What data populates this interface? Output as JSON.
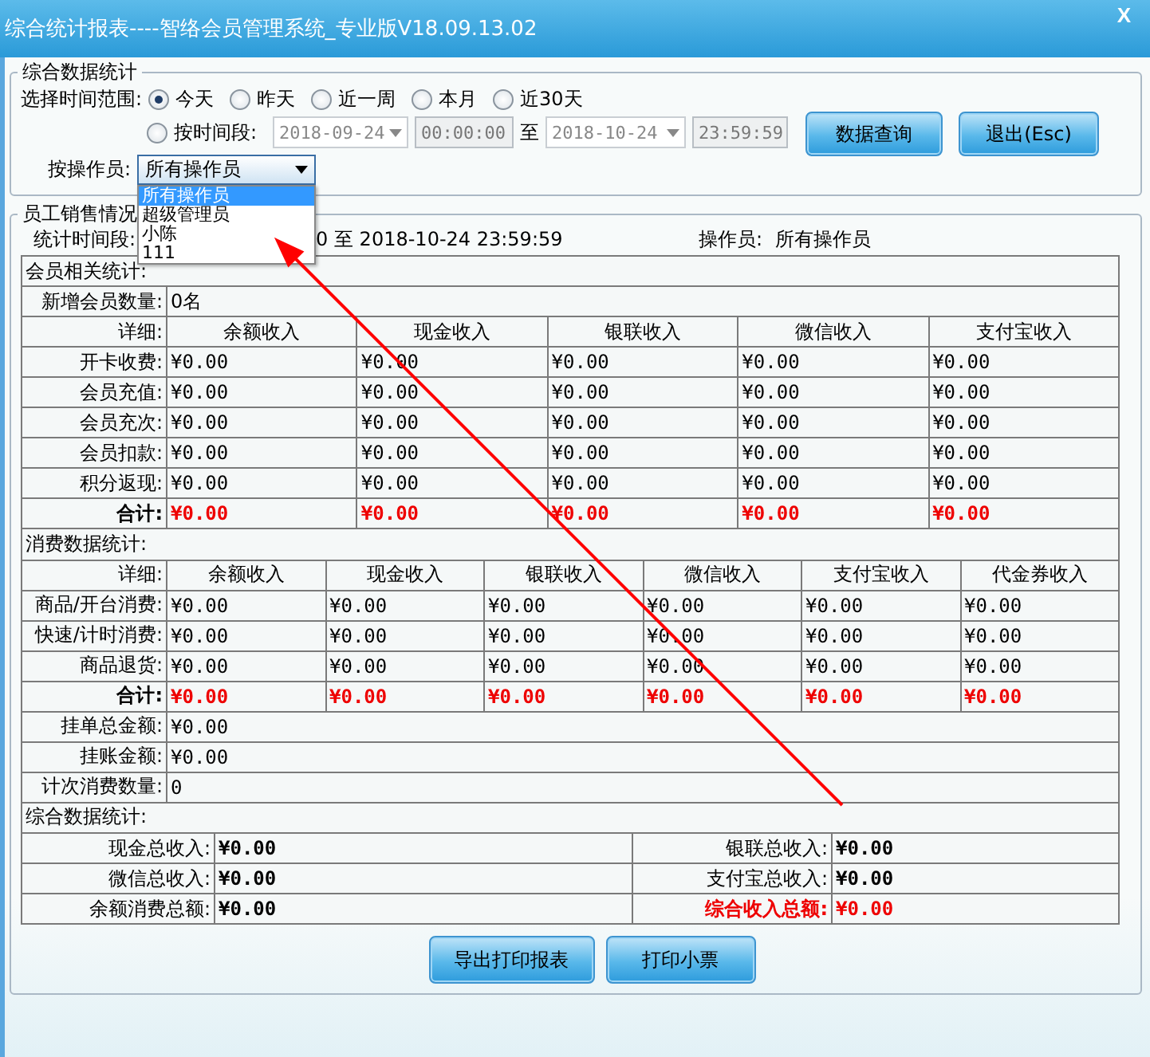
{
  "window": {
    "title": "综合统计报表----智络会员管理系统_专业版V18.09.13.02",
    "close": "X"
  },
  "query": {
    "group_title": "综合数据统计",
    "range_label": "选择时间范围:",
    "ranges": [
      {
        "label": "今天",
        "selected": true
      },
      {
        "label": "昨天",
        "selected": false
      },
      {
        "label": "近一周",
        "selected": false
      },
      {
        "label": "本月",
        "selected": false
      },
      {
        "label": "近30天",
        "selected": false
      }
    ],
    "custom": {
      "label": "按时间段:",
      "selected": false,
      "start_date": "2018-09-24",
      "start_time": "00:00:00",
      "to": "至",
      "end_date": "2018-10-24",
      "end_time": "23:59:59"
    },
    "buttons": [
      "数据查询",
      "退出(Esc)"
    ],
    "operator_label": "按操作员:",
    "operator_value": "所有操作员",
    "expanded": true,
    "operator_options": [
      {
        "label": "所有操作员",
        "selected": true
      },
      {
        "label": "超级管理员",
        "selected": false
      },
      {
        "label": "小陈",
        "selected": false
      },
      {
        "label": "111",
        "selected": false
      }
    ]
  },
  "staff": {
    "group_title": "员工销售情况",
    "period_label": "统计时间段:",
    "period_value": "0 至 2018-10-24 23:59:59",
    "operator_label": "操作员:",
    "operator_value": "所有操作员"
  },
  "member": {
    "title": "会员相关统计:",
    "new_label": "新增会员数量:",
    "new_value": "0名",
    "columns": [
      "详细:",
      "余额收入",
      "现金收入",
      "银联收入",
      "微信收入",
      "支付宝收入"
    ],
    "rows": [
      {
        "label": "开卡收费:",
        "values": [
          "¥0.00",
          "¥0.00",
          "¥0.00",
          "¥0.00",
          "¥0.00"
        ]
      },
      {
        "label": "会员充值:",
        "values": [
          "¥0.00",
          "¥0.00",
          "¥0.00",
          "¥0.00",
          "¥0.00"
        ]
      },
      {
        "label": "会员充次:",
        "values": [
          "¥0.00",
          "¥0.00",
          "¥0.00",
          "¥0.00",
          "¥0.00"
        ]
      },
      {
        "label": "会员扣款:",
        "values": [
          "¥0.00",
          "¥0.00",
          "¥0.00",
          "¥0.00",
          "¥0.00"
        ]
      },
      {
        "label": "积分返现:",
        "values": [
          "¥0.00",
          "¥0.00",
          "¥0.00",
          "¥0.00",
          "¥0.00"
        ]
      }
    ],
    "total": {
      "label": "合计:",
      "values": [
        "¥0.00",
        "¥0.00",
        "¥0.00",
        "¥0.00",
        "¥0.00"
      ]
    }
  },
  "consumption": {
    "title": "消费数据统计:",
    "columns": [
      "详细:",
      "余额收入",
      "现金收入",
      "银联收入",
      "微信收入",
      "支付宝收入",
      "代金券收入"
    ],
    "rows": [
      {
        "label": "商品/开台消费:",
        "values": [
          "¥0.00",
          "¥0.00",
          "¥0.00",
          "¥0.00",
          "¥0.00",
          "¥0.00"
        ]
      },
      {
        "label": "快速/计时消费:",
        "values": [
          "¥0.00",
          "¥0.00",
          "¥0.00",
          "¥0.00",
          "¥0.00",
          "¥0.00"
        ]
      },
      {
        "label": "商品退货:",
        "values": [
          "¥0.00",
          "¥0.00",
          "¥0.00",
          "¥0.00",
          "¥0.00",
          "¥0.00"
        ]
      }
    ],
    "total": {
      "label": "合计:",
      "values": [
        "¥0.00",
        "¥0.00",
        "¥0.00",
        "¥0.00",
        "¥0.00",
        "¥0.00"
      ]
    },
    "extras": [
      {
        "label": "挂单总金额:",
        "value": "¥0.00"
      },
      {
        "label": "挂账金额:",
        "value": "¥0.00"
      },
      {
        "label": "计次消费数量:",
        "value": "0"
      }
    ]
  },
  "summary": {
    "title": "综合数据统计:",
    "rows": [
      [
        {
          "label": "现金总收入:",
          "value": "¥0.00",
          "highlight": false
        },
        {
          "label": "银联总收入:",
          "value": "¥0.00",
          "highlight": false
        }
      ],
      [
        {
          "label": "微信总收入:",
          "value": "¥0.00",
          "highlight": false
        },
        {
          "label": "支付宝总收入:",
          "value": "¥0.00",
          "highlight": false
        }
      ],
      [
        {
          "label": "余额消费总额:",
          "value": "¥0.00",
          "highlight": false
        },
        {
          "label": "综合收入总额:",
          "value": "¥0.00",
          "highlight": true
        }
      ]
    ]
  },
  "footer_buttons": [
    "导出打印报表",
    "打印小票"
  ]
}
